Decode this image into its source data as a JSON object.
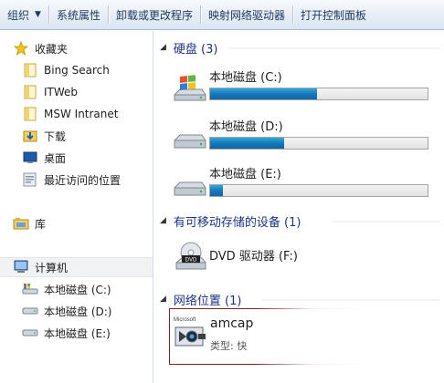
{
  "toolbar": {
    "organize_label": "组织",
    "system_properties_label": "系统属性",
    "uninstall_label": "卸载或更改程序",
    "map_drive_label": "映射网络驱动器",
    "control_panel_label": "打开控制面板"
  },
  "nav": {
    "favorites": {
      "label": "收藏夹",
      "items": [
        {
          "label": "Bing Search"
        },
        {
          "label": "ITWeb"
        },
        {
          "label": "MSW Intranet"
        },
        {
          "label": "下载"
        },
        {
          "label": "桌面"
        },
        {
          "label": "最近访问的位置"
        }
      ]
    },
    "libraries": {
      "label": "库"
    },
    "computer": {
      "label": "计算机",
      "drives": [
        {
          "label": "本地磁盘 (C:)"
        },
        {
          "label": "本地磁盘 (D:)"
        },
        {
          "label": "本地磁盘 (E:)"
        }
      ]
    }
  },
  "content": {
    "hard_disks": {
      "header": "硬盘 (3)",
      "drives": [
        {
          "name": "本地磁盘 (C:)",
          "used_fraction": 0.49
        },
        {
          "name": "本地磁盘 (D:)",
          "used_fraction": 0.34
        },
        {
          "name": "本地磁盘 (E:)",
          "used_fraction": 0.06
        }
      ]
    },
    "removable": {
      "header": "有可移动存储的设备 (1)",
      "devices": [
        {
          "name": "DVD 驱动器 (F:)",
          "badge": "DVD"
        }
      ]
    },
    "network": {
      "header": "网络位置 (1)",
      "item": {
        "name": "amcap",
        "subtitle": "类型: 快",
        "icon_text": "Microsoft"
      }
    }
  },
  "colors": {
    "accent": "#1e3287",
    "bar_fill": "#1777b8",
    "selection_border": "#8a1d1d"
  }
}
